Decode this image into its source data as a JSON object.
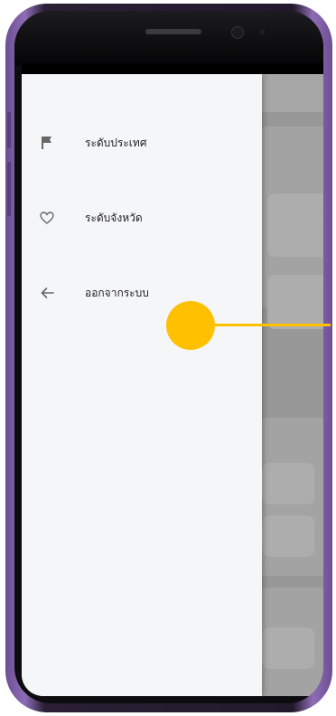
{
  "drawer": {
    "items": [
      {
        "label": "ระดับประเทศ",
        "icon": "flag-icon"
      },
      {
        "label": "ระดับจังหวัด",
        "icon": "heart-outline-icon"
      },
      {
        "label": "ออกจากระบบ",
        "icon": "arrow-left-icon"
      }
    ]
  },
  "colors": {
    "accent": "#ffc000",
    "drawer_bg": "#f5f6f8",
    "scrim": "#989898"
  }
}
